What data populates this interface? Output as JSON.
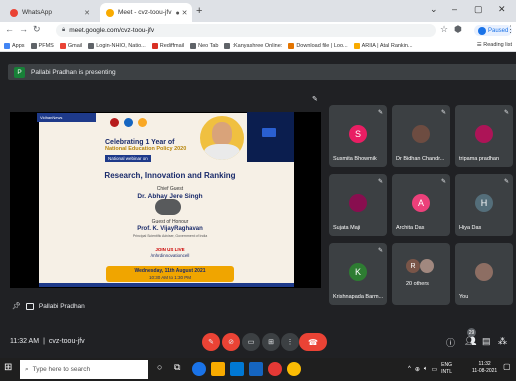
{
  "browser": {
    "tabs": [
      {
        "label": "WhatsApp",
        "active": false,
        "favicon_color": "#ea4335"
      },
      {
        "label": "Meet - cvz-toou-jfv",
        "active": true,
        "favicon_color": "#f9ab00"
      }
    ],
    "new_tab": "+",
    "window_controls": [
      "⌄",
      "–",
      "▢",
      "✕"
    ],
    "address": "meet.google.com/cvz-toou-jfv",
    "paused_label": "Paused",
    "bookmarks": [
      {
        "label": "Apps",
        "color": "#4285f4"
      },
      {
        "label": "PFMS",
        "color": "#5f6368"
      },
      {
        "label": "Gmail",
        "color": "#ea4335"
      },
      {
        "label": "Login-NHIO, Natio...",
        "color": "#5f6368"
      },
      {
        "label": "Rediffmail",
        "color": "#d93025"
      },
      {
        "label": "Neo Tab",
        "color": "#5f6368"
      },
      {
        "label": ":Kanyashree Online:",
        "color": "#5f6368"
      },
      {
        "label": "Download file | Loo...",
        "color": "#e37400"
      },
      {
        "label": "ARIIA | Atal Rankin...",
        "color": "#f9ab00"
      }
    ],
    "reading_list": "Reading list"
  },
  "meet": {
    "presenting_initial": "P",
    "presenting_text": "Pallabi Pradhan is presenting",
    "stage_name": "Pallabi Pradhan",
    "slide": {
      "left_banner": "VidhanNews",
      "title_line1": "Celebrating 1 Year of",
      "title_line2": "National Education Policy 2020",
      "webinar": "National webinar on",
      "heading": "Research, Innovation and Ranking",
      "chief_label": "Chief Guest",
      "chief_name": "Dr. Abhay Jere Singh",
      "honour_label": "Guest of Honour",
      "honour_name": "Prof. K. VijayRaghavan",
      "honour_desc": "Principal Scientific Adviser, Government of India",
      "join": "JOIN US LIVE",
      "handle": "/mhrdinnovationcell",
      "date": "Wednesday, 11th August 2021",
      "time": "10:30 AM to 1:30 PM"
    },
    "participants": [
      {
        "name": "Susmita Bhowmik",
        "avatar": "S",
        "color": "#e91e63"
      },
      {
        "name": "Dr Bidhan Chandr...",
        "avatar": "",
        "color": "#6d4c41"
      },
      {
        "name": "tripama pradhan",
        "avatar": "",
        "color": "#ad1457"
      },
      {
        "name": "Sujata Maji",
        "avatar": "",
        "color": "#880e4f"
      },
      {
        "name": "Archita Das",
        "avatar": "A",
        "color": "#ec407a"
      },
      {
        "name": "Hiya Das",
        "avatar": "H",
        "color": "#546e7a"
      },
      {
        "name": "Krishnapada Barm...",
        "avatar": "K",
        "color": "#2e7d32"
      },
      {
        "name": "20 others",
        "avatar": "R",
        "color": "#795548"
      },
      {
        "name": "You",
        "avatar": "",
        "color": "#8d6e63"
      }
    ],
    "meeting_time": "11:32 AM",
    "separator": "|",
    "meeting_code": "cvz-toou-jfv",
    "people_count": "29"
  },
  "taskbar": {
    "search_placeholder": "Type here to search",
    "lang": "ENG",
    "region": "INTL",
    "time": "11:32",
    "date": "11-08-2021"
  }
}
